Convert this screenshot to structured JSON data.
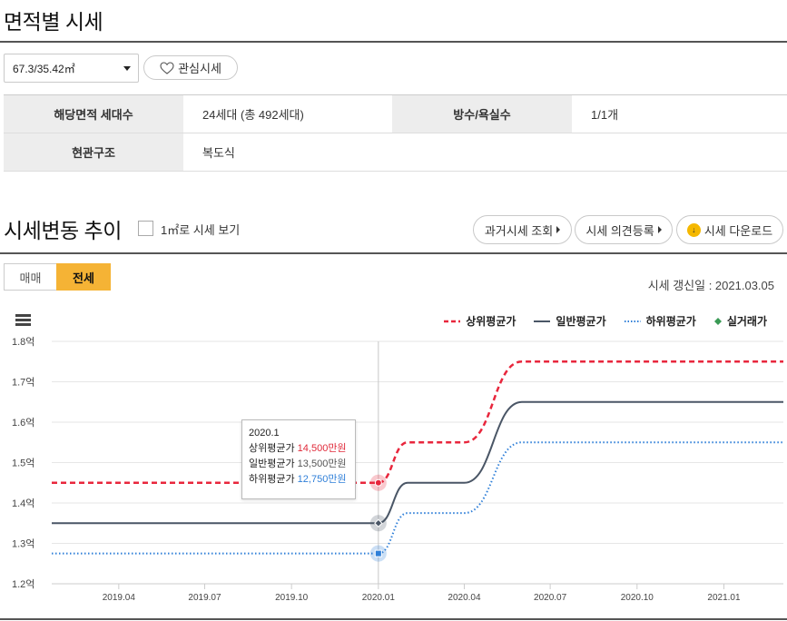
{
  "header": {
    "title": "면적별 시세"
  },
  "area_select": {
    "value": "67.3/35.42㎡"
  },
  "favorite": {
    "label": "관심시세",
    "icon": "heart-outline-icon"
  },
  "info_table": {
    "row1": {
      "label1": "해당면적 세대수",
      "value1": "24세대 (총 492세대)",
      "label2": "방수/욕실수",
      "value2": "1/1개"
    },
    "row2": {
      "label1": "현관구조",
      "value1": "복도식"
    }
  },
  "trend": {
    "title": "시세변동 추이",
    "checkbox_label": "1㎡로 시세 보기",
    "buttons": {
      "history": "과거시세 조회",
      "opinion": "시세 의견등록",
      "download": "시세 다운로드"
    },
    "tabs": {
      "sale": "매매",
      "jeonse": "전세"
    },
    "updated": "시세 갱신일 : 2021.03.05"
  },
  "legend": {
    "upper": "상위평균가",
    "general": "일반평균가",
    "lower": "하위평균가",
    "real": "실거래가"
  },
  "colors": {
    "upper": "#e8263c",
    "general": "#4a5666",
    "lower": "#2f7fd8",
    "real": "#3a9a55",
    "accent": "#f5b335"
  },
  "tooltip": {
    "date": "2020.1",
    "upper_label": "상위평균가",
    "upper_value": "14,500만원",
    "general_label": "일반평균가",
    "general_value": "13,500만원",
    "lower_label": "하위평균가",
    "lower_value": "12,750만원"
  },
  "chart_data": {
    "type": "line",
    "y_tick_labels": [
      "1.8억",
      "1.7억",
      "1.6억",
      "1.5억",
      "1.4억",
      "1.3억",
      "1.2억"
    ],
    "y_ticks": [
      1.8,
      1.7,
      1.6,
      1.5,
      1.4,
      1.3,
      1.2
    ],
    "ylim": [
      1.2,
      1.8
    ],
    "x_tick_labels": [
      "2019.04",
      "2019.07",
      "2019.10",
      "2020.01",
      "2020.04",
      "2020.07",
      "2020.10",
      "2021.01"
    ],
    "x_ticks": [
      "2019-04",
      "2019-07",
      "2019-10",
      "2020-01",
      "2020-04",
      "2020-07",
      "2020-10",
      "2021-01"
    ],
    "xlim": [
      "2019-01-20",
      "2021-03-05"
    ],
    "series": [
      {
        "name": "상위평균가",
        "style": "dashed",
        "points": [
          [
            "2019-01-20",
            1.45
          ],
          [
            "2020-01-01",
            1.45
          ],
          [
            "2020-02-01",
            1.55
          ],
          [
            "2020-04-01",
            1.55
          ],
          [
            "2020-06-01",
            1.75
          ],
          [
            "2021-03-05",
            1.75
          ]
        ]
      },
      {
        "name": "일반평균가",
        "style": "solid",
        "points": [
          [
            "2019-01-20",
            1.35
          ],
          [
            "2020-01-01",
            1.35
          ],
          [
            "2020-02-01",
            1.45
          ],
          [
            "2020-04-01",
            1.45
          ],
          [
            "2020-06-01",
            1.65
          ],
          [
            "2021-03-05",
            1.65
          ]
        ]
      },
      {
        "name": "하위평균가",
        "style": "dotted",
        "points": [
          [
            "2019-01-20",
            1.275
          ],
          [
            "2020-01-01",
            1.275
          ],
          [
            "2020-02-01",
            1.375
          ],
          [
            "2020-04-01",
            1.375
          ],
          [
            "2020-06-01",
            1.55
          ],
          [
            "2021-03-05",
            1.55
          ]
        ]
      }
    ],
    "highlight": "2020-01-01",
    "grid": true,
    "legend": "top-right"
  }
}
